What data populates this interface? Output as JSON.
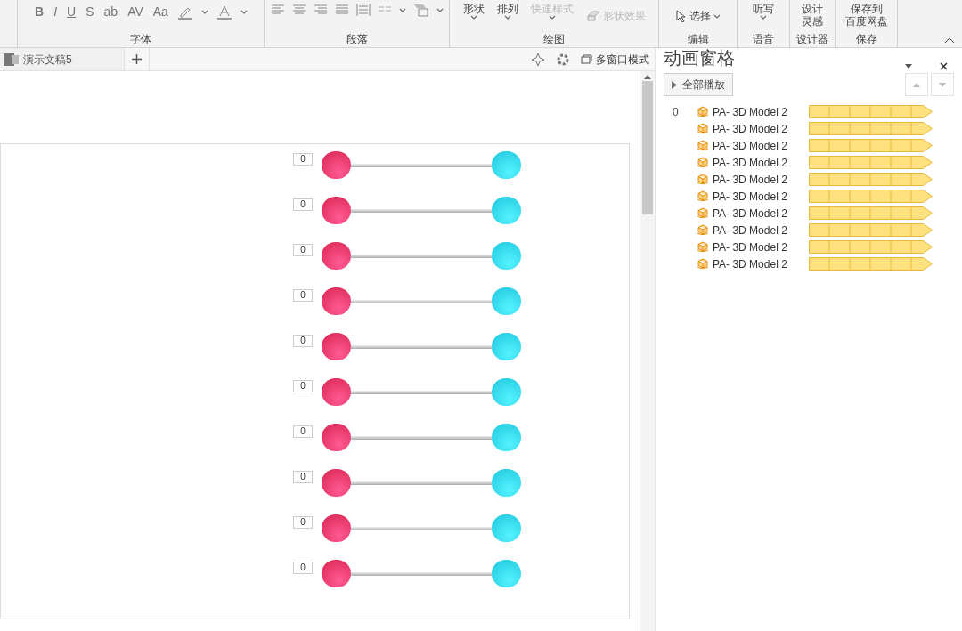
{
  "ribbon": {
    "font_group": {
      "buttons": [
        "B",
        "I",
        "U",
        "S",
        "ab",
        "AV",
        "Aa"
      ],
      "label": "字体"
    },
    "paragraph_group": {
      "label": "段落"
    },
    "drawing_group": {
      "buttons": [
        {
          "label": "形状",
          "disabled": false
        },
        {
          "label": "排列",
          "disabled": false
        },
        {
          "label": "快速样式",
          "disabled": true
        }
      ],
      "effects": {
        "label": "形状效果",
        "disabled": true
      },
      "label": "绘图"
    },
    "editing_group": {
      "select": "选择",
      "label": "编辑"
    },
    "voice_group": {
      "button": "听写",
      "label": "语音"
    },
    "designer_group": {
      "button": [
        "设计",
        "灵感"
      ],
      "label": "设计器"
    },
    "save_group": {
      "button": [
        "保存到",
        "百度网盘"
      ],
      "label": "保存"
    }
  },
  "doc_tabs": [
    {
      "label": "演示文稿5",
      "selected": true
    }
  ],
  "toolbar": {
    "multi_window": "多窗口模式"
  },
  "slide": {
    "rows": [
      {
        "counter": "0"
      },
      {
        "counter": "0"
      },
      {
        "counter": "0"
      },
      {
        "counter": "0"
      },
      {
        "counter": "0"
      },
      {
        "counter": "0"
      },
      {
        "counter": "0"
      },
      {
        "counter": "0"
      },
      {
        "counter": "0"
      },
      {
        "counter": "0"
      }
    ]
  },
  "animation_pane": {
    "title": "动画窗格",
    "play_all": "全部播放",
    "items": [
      {
        "index": "0",
        "label": "PA- 3D Model 2"
      },
      {
        "label": "PA- 3D Model 2"
      },
      {
        "label": "PA- 3D Model 2"
      },
      {
        "label": "PA- 3D Model 2"
      },
      {
        "label": "PA- 3D Model 2"
      },
      {
        "label": "PA- 3D Model 2"
      },
      {
        "label": "PA- 3D Model 2"
      },
      {
        "label": "PA- 3D Model 2"
      },
      {
        "label": "PA- 3D Model 2"
      },
      {
        "label": "PA- 3D Model 2"
      }
    ]
  }
}
